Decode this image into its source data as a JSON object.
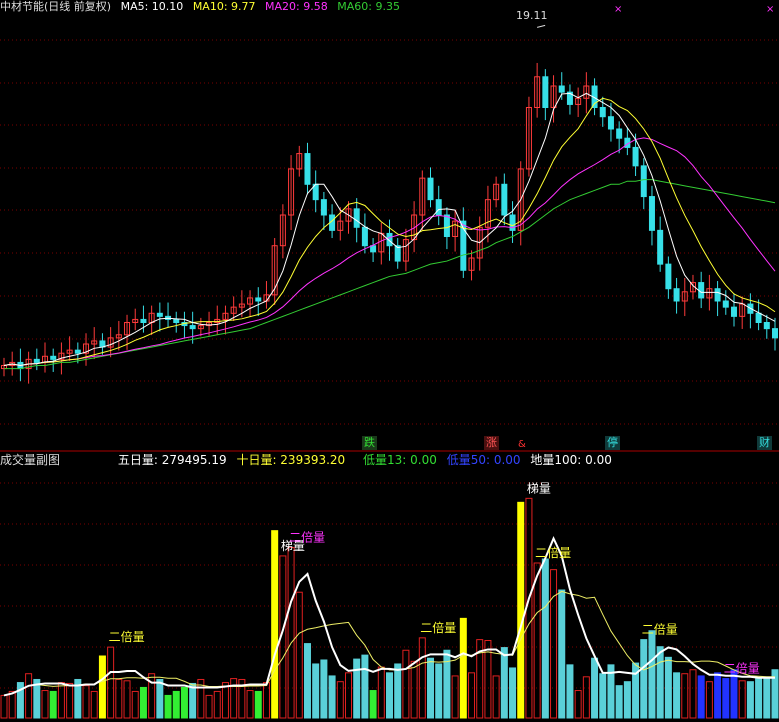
{
  "colors": {
    "bg": "#000000",
    "grid": "#7a0000",
    "candle_up": "#ff3b3b",
    "candle_down": "#37e0e8",
    "ma5": "#ffffff",
    "ma10": "#ffff33",
    "ma20": "#ff33ff",
    "ma60": "#33cc33",
    "vol_up": "#e02020",
    "vol_down": "#5ad0d8",
    "vol_double": "#ffff00",
    "vol_ladder": "#ff33ff",
    "vol_low": "#33ee33",
    "vol_lowest": "#2233ff",
    "line5": "#ffffff",
    "line10": "#eeee66"
  },
  "header": {
    "title": "中材节能(日线 前复权)",
    "ma5": "MA5: 10.10",
    "ma10": "MA10: 9.77",
    "ma20": "MA20: 9.58",
    "ma60": "MA60: 9.35"
  },
  "peak_label": "19.11",
  "events": [
    {
      "text": "跌",
      "color": "#33dd33",
      "bg": "#1a3a1a"
    },
    {
      "text": "涨",
      "color": "#ff5555",
      "bg": "#4a1010"
    },
    {
      "text": "&",
      "color": "#ff3333",
      "bg": ""
    },
    {
      "text": "停",
      "color": "#33dddd",
      "bg": "#103a3a"
    },
    {
      "text": "财",
      "color": "#33dddd",
      "bg": "#103a3a"
    }
  ],
  "subchart": {
    "title": "成交量副图",
    "v5": "五日量: 279495.19",
    "v10": "十日量: 239393.20",
    "low13": "低量13: 0.00",
    "low50": "低量50: 0.00",
    "ground100": "地量100: 0.00"
  },
  "annotations": {
    "double": "二倍量",
    "ladder": "梯量"
  },
  "chart_data": {
    "type": "candlestick",
    "closes": [
      8.1,
      8.2,
      8.0,
      8.3,
      8.2,
      8.4,
      8.3,
      8.5,
      8.6,
      8.5,
      8.8,
      8.9,
      8.7,
      9.0,
      9.1,
      9.5,
      9.6,
      9.5,
      9.8,
      9.7,
      9.6,
      9.5,
      9.4,
      9.3,
      9.4,
      9.5,
      9.6,
      9.8,
      10.0,
      10.1,
      10.3,
      10.2,
      10.4,
      12.0,
      13.0,
      14.5,
      15.0,
      14.0,
      13.5,
      13.0,
      12.5,
      12.8,
      13.2,
      12.6,
      12.0,
      11.8,
      12.4,
      12.0,
      11.5,
      12.2,
      13.0,
      14.2,
      13.5,
      13.0,
      12.3,
      12.8,
      11.2,
      11.6,
      12.6,
      13.5,
      14.0,
      13.0,
      12.5,
      14.5,
      16.5,
      17.5,
      16.5,
      17.2,
      17.0,
      16.6,
      16.8,
      17.2,
      16.5,
      16.2,
      15.8,
      15.5,
      15.2,
      14.6,
      13.6,
      12.5,
      11.4,
      10.6,
      10.2,
      10.5,
      10.8,
      10.3,
      10.6,
      10.2,
      10.0,
      9.7,
      10.1,
      9.8,
      9.5,
      9.3,
      9.0
    ],
    "ma60": [
      8.0,
      8.0,
      8.0,
      8.05,
      8.1,
      8.1,
      8.15,
      8.2,
      8.2,
      8.25,
      8.3,
      8.35,
      8.4,
      8.45,
      8.5,
      8.55,
      8.6,
      8.65,
      8.7,
      8.75,
      8.8,
      8.85,
      8.9,
      8.95,
      9.0,
      9.05,
      9.1,
      9.15,
      9.2,
      9.25,
      9.3,
      9.4,
      9.5,
      9.6,
      9.7,
      9.8,
      9.9,
      10.0,
      10.1,
      10.2,
      10.3,
      10.4,
      10.5,
      10.6,
      10.7,
      10.8,
      10.9,
      11.0,
      11.05,
      11.1,
      11.2,
      11.3,
      11.4,
      11.45,
      11.5,
      11.6,
      11.7,
      11.75,
      11.85,
      11.95,
      12.1,
      12.2,
      12.3,
      12.45,
      12.6,
      12.8,
      13.0,
      13.2,
      13.35,
      13.5,
      13.6,
      13.7,
      13.8,
      13.9,
      14.0,
      14.0,
      14.1,
      14.1,
      14.15,
      14.15,
      14.1,
      14.05,
      14.0,
      13.95,
      13.9,
      13.85,
      13.8,
      13.75,
      13.7,
      13.65,
      13.6,
      13.55,
      13.5,
      13.45,
      13.4
    ],
    "price_range": [
      6.0,
      20.0
    ],
    "peak_value": 19.11,
    "volume_range": [
      0,
      560000
    ],
    "five_day_volume": 279495.19,
    "ten_day_volume": 239393.2
  }
}
